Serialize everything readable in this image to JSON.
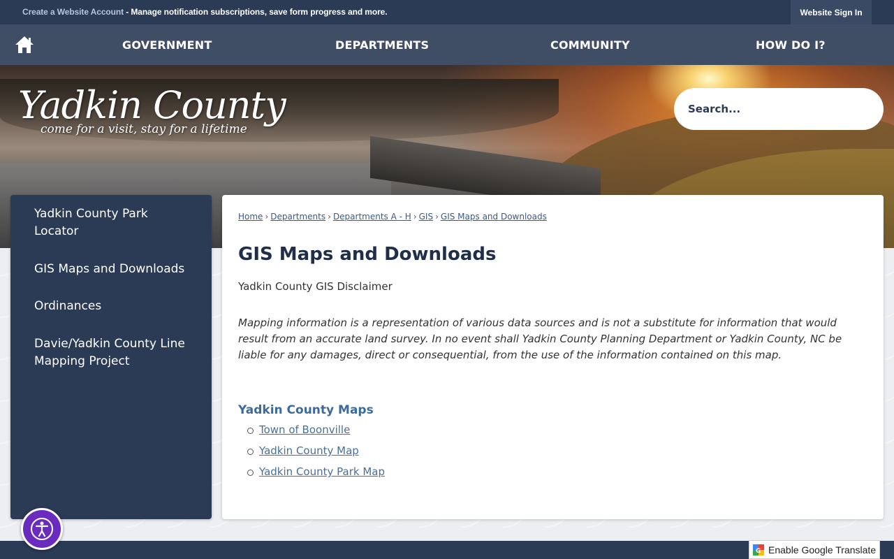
{
  "topbar": {
    "create_link": "Create a Website Account",
    "message": " - Manage notification subscriptions, save form progress and more.",
    "signin": "Website Sign In"
  },
  "nav": {
    "home_icon": "home-icon",
    "items": [
      "GOVERNMENT",
      "DEPARTMENTS",
      "COMMUNITY",
      "HOW DO I?"
    ]
  },
  "logo": {
    "name": "Yadkin County",
    "tagline": "come for a visit, stay for a lifetime"
  },
  "search": {
    "placeholder": "Search...",
    "icon": "search-icon"
  },
  "sidebar": {
    "items": [
      "Yadkin County Park Locator",
      "GIS Maps and Downloads",
      "Ordinances",
      "Davie/Yadkin County Line Mapping Project"
    ]
  },
  "breadcrumb": [
    "Home",
    "Departments",
    "Departments A - H",
    "GIS",
    "GIS Maps and Downloads"
  ],
  "main": {
    "title": "GIS Maps and Downloads",
    "disclaimer_title": "Yadkin County GIS Disclaimer",
    "disclaimer_text": "Mapping information is a representation of various data sources and is not a substitute for information that would result from an accurate land survey. In no event shall Yadkin County Planning Department or Yadkin County, NC be liable for any damages, direct or consequential, from the use of the information contained on this map.",
    "maps_heading": "Yadkin County Maps",
    "maps": [
      "Town of Boonville",
      "Yadkin County Map",
      "Yadkin County Park Map"
    ]
  },
  "translate": {
    "label": "Enable Google Translate"
  },
  "accessibility": {
    "icon": "accessibility-icon"
  },
  "colors": {
    "navy": "#2b3a55",
    "link": "#4a6f98",
    "accessibility_purple": "#6a2bbf"
  }
}
